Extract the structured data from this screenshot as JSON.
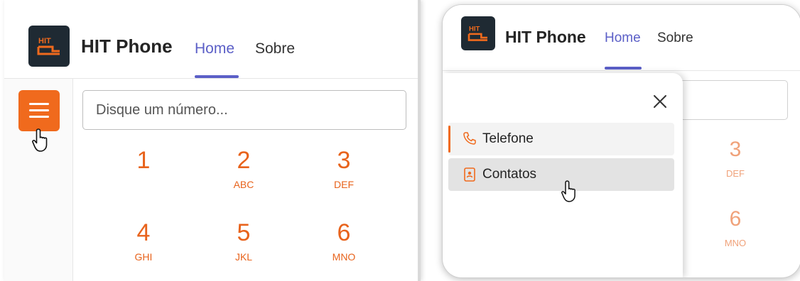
{
  "app": {
    "title": "HIT Phone",
    "logo_text": "HIT"
  },
  "nav": {
    "home": "Home",
    "about": "Sobre"
  },
  "dialer": {
    "placeholder": "Disque um número...",
    "keys": [
      {
        "digit": "1",
        "letters": ""
      },
      {
        "digit": "2",
        "letters": "ABC"
      },
      {
        "digit": "3",
        "letters": "DEF"
      },
      {
        "digit": "4",
        "letters": "GHI"
      },
      {
        "digit": "5",
        "letters": "JKL"
      },
      {
        "digit": "6",
        "letters": "MNO"
      }
    ]
  },
  "drawer": {
    "items": [
      {
        "label": "Telefone",
        "icon": "phone-icon",
        "selected": true
      },
      {
        "label": "Contatos",
        "icon": "contact-card-icon",
        "selected": false
      }
    ]
  },
  "colors": {
    "accent": "#f06a1d",
    "nav_active": "#5b5fc7",
    "logo_bg": "#1f2a33"
  }
}
